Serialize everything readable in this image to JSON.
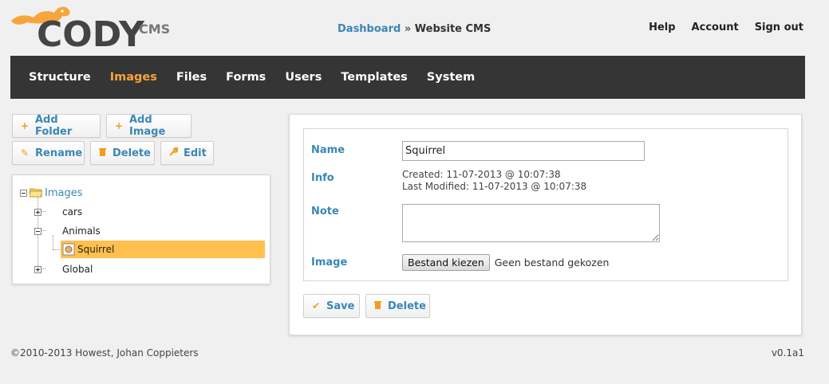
{
  "header": {
    "logo_text": "CODY",
    "logo_suffix": "CMS",
    "breadcrumb": {
      "link": "Dashboard",
      "separator": "»",
      "current": "Website CMS"
    },
    "links": [
      "Help",
      "Account",
      "Sign out"
    ]
  },
  "nav": {
    "items": [
      {
        "label": "Structure",
        "active": false
      },
      {
        "label": "Images",
        "active": true
      },
      {
        "label": "Files",
        "active": false
      },
      {
        "label": "Forms",
        "active": false
      },
      {
        "label": "Users",
        "active": false
      },
      {
        "label": "Templates",
        "active": false
      },
      {
        "label": "System",
        "active": false
      }
    ]
  },
  "toolbar": {
    "add_folder": "Add Folder",
    "add_image": "Add Image",
    "rename": "Rename",
    "delete": "Delete",
    "edit": "Edit"
  },
  "tree": {
    "root": "Images",
    "items": [
      "cars",
      "Animals",
      "Squirrel",
      "Global"
    ],
    "selected": "Squirrel"
  },
  "form": {
    "name_label": "Name",
    "name_value": "Squirrel",
    "info_label": "Info",
    "created": "Created: 11-07-2013 @ 10:07:38",
    "modified": "Last Modified: 11-07-2013 @ 10:07:38",
    "note_label": "Note",
    "note_value": "",
    "image_label": "Image",
    "file_button": "Bestand kiezen",
    "file_status": "Geen bestand gekozen",
    "save": "Save",
    "delete": "Delete"
  },
  "footer": {
    "copyright": "©2010-2013 Howest, Johan Coppieters",
    "version": "v0.1a1"
  },
  "colors": {
    "accent": "#f7a53b",
    "link": "#3a87b5",
    "nav_bg": "#353535",
    "selection": "#ffc04d"
  }
}
